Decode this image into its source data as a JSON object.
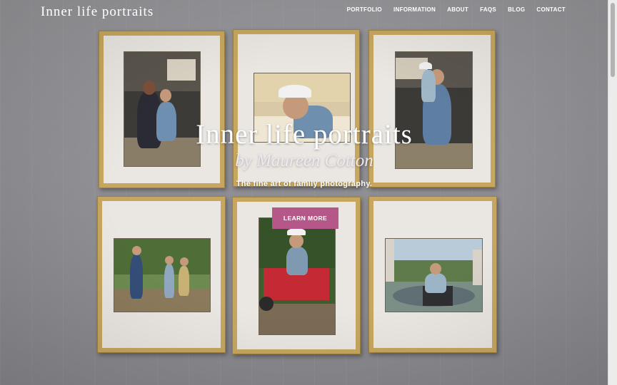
{
  "header": {
    "logo_text": "Inner life portraits",
    "nav": [
      "PORTFOLIO",
      "INFORMATION",
      "ABOUT",
      "FAQS",
      "BLOG",
      "CONTACT"
    ]
  },
  "hero": {
    "title": "Inner life portraits",
    "subtitle": "by Maureen Cotton",
    "tagline": "The fine art of family photography.",
    "cta_label": "LEARN MORE"
  },
  "colors": {
    "cta": "#b6578a",
    "frame": "#c7a75f",
    "mat": "#eae7e2"
  }
}
